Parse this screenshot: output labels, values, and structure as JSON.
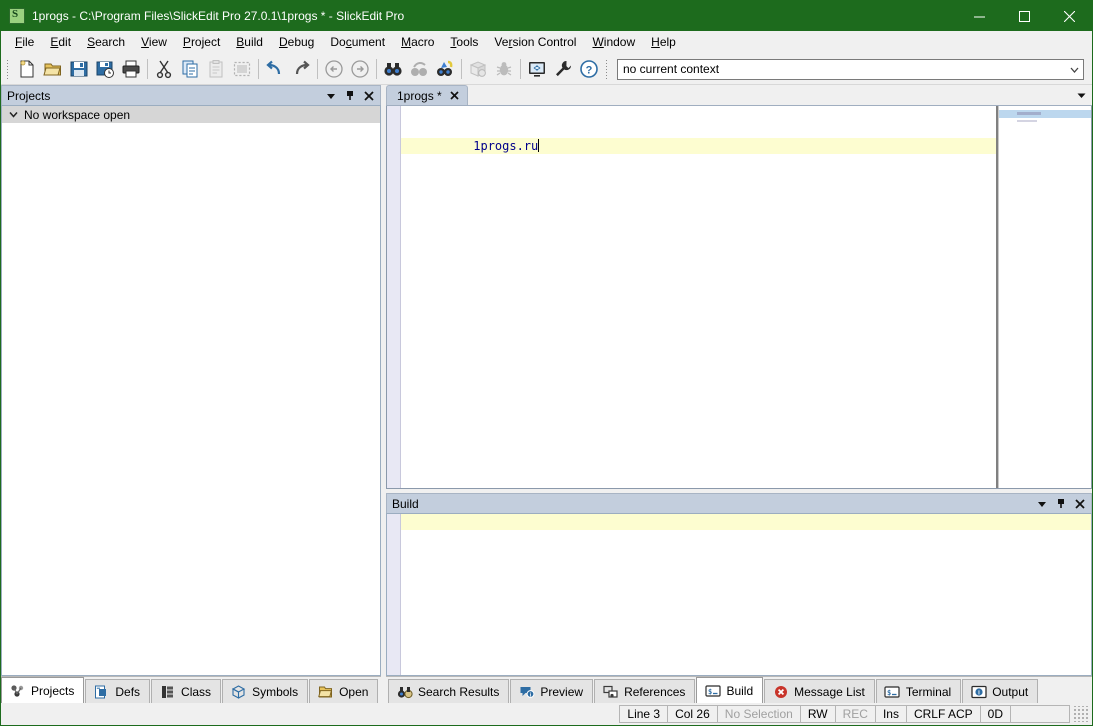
{
  "window": {
    "title": "1progs - C:\\Program Files\\SlickEdit Pro 27.0.1\\1progs * - SlickEdit Pro",
    "app_icon": "slickedit-icon",
    "minimize_label": "Minimize",
    "maximize_label": "Maximize",
    "close_label": "Close",
    "titlebar_color": "#1d6b1d"
  },
  "menubar": {
    "items": [
      {
        "label": "File",
        "accel": "F"
      },
      {
        "label": "Edit",
        "accel": "E"
      },
      {
        "label": "Search",
        "accel": "S"
      },
      {
        "label": "View",
        "accel": "V"
      },
      {
        "label": "Project",
        "accel": "P"
      },
      {
        "label": "Build",
        "accel": "B"
      },
      {
        "label": "Debug",
        "accel": "D"
      },
      {
        "label": "Document",
        "accel": "c"
      },
      {
        "label": "Macro",
        "accel": "M"
      },
      {
        "label": "Tools",
        "accel": "T"
      },
      {
        "label": "Version Control",
        "accel": "r"
      },
      {
        "label": "Window",
        "accel": "W"
      },
      {
        "label": "Help",
        "accel": "H"
      }
    ]
  },
  "toolbar": {
    "buttons": [
      {
        "name": "new-file-icon",
        "tip": "New",
        "enabled": true
      },
      {
        "name": "open-folder-icon",
        "tip": "Open",
        "enabled": true
      },
      {
        "name": "save-icon",
        "tip": "Save",
        "enabled": true
      },
      {
        "name": "save-as-icon",
        "tip": "Save As",
        "enabled": true
      },
      {
        "name": "print-icon",
        "tip": "Print",
        "enabled": true
      },
      {
        "name": "cut-icon",
        "tip": "Cut",
        "enabled": true
      },
      {
        "name": "copy-icon",
        "tip": "Copy",
        "enabled": true
      },
      {
        "name": "paste-icon",
        "tip": "Paste",
        "enabled": false
      },
      {
        "name": "select-all-icon",
        "tip": "Select All",
        "enabled": false
      },
      {
        "name": "undo-icon",
        "tip": "Undo",
        "enabled": true
      },
      {
        "name": "redo-icon",
        "tip": "Redo",
        "enabled": true
      },
      {
        "name": "back-arrow-icon",
        "tip": "Back",
        "enabled": false
      },
      {
        "name": "forward-arrow-icon",
        "tip": "Forward",
        "enabled": false
      },
      {
        "name": "find-icon",
        "tip": "Find",
        "enabled": true
      },
      {
        "name": "find-previous-icon",
        "tip": "Find Previous",
        "enabled": false
      },
      {
        "name": "find-next-icon",
        "tip": "Find Next",
        "enabled": true
      },
      {
        "name": "build-icon",
        "tip": "Build",
        "enabled": false
      },
      {
        "name": "debug-bug-icon",
        "tip": "Debug",
        "enabled": false
      },
      {
        "name": "monitor-icon",
        "tip": "Full Screen",
        "enabled": true
      },
      {
        "name": "wrench-icon",
        "tip": "Configuration",
        "enabled": true
      },
      {
        "name": "help-icon",
        "tip": "Help",
        "enabled": true
      }
    ],
    "context_combo": {
      "value": "no current context",
      "arrow_icon": "chevron-down-icon"
    }
  },
  "projects_panel": {
    "title": "Projects",
    "buttons": [
      {
        "name": "panel-menu-icon",
        "glyph": "menu-down"
      },
      {
        "name": "panel-pin-icon",
        "glyph": "pin"
      },
      {
        "name": "panel-close-icon",
        "glyph": "close"
      }
    ],
    "tree": [
      {
        "label": "No workspace open",
        "expander": "chevron-down-icon",
        "selected": true
      }
    ]
  },
  "left_tabs": {
    "tabs": [
      {
        "label": "Projects",
        "icon": "projects-icon",
        "active": true
      },
      {
        "label": "Defs",
        "icon": "defs-icon",
        "active": false
      },
      {
        "label": "Class",
        "icon": "class-icon",
        "active": false
      },
      {
        "label": "Symbols",
        "icon": "symbols-icon",
        "active": false
      },
      {
        "label": "Open",
        "icon": "open-folder-icon",
        "active": false
      }
    ]
  },
  "editor": {
    "tabs": [
      {
        "label": "1progs *",
        "active": true,
        "close_icon": "close-icon"
      }
    ],
    "tabrow_arrow": "chevron-down-icon",
    "lines": [
      {
        "text": "",
        "current": false
      },
      {
        "text": "",
        "current": false
      },
      {
        "text": "          1progs.ru",
        "current": true,
        "caret": true
      }
    ]
  },
  "build_panel": {
    "title": "Build",
    "buttons": [
      {
        "name": "panel-menu-icon",
        "glyph": "menu-down"
      },
      {
        "name": "panel-pin-icon",
        "glyph": "pin"
      },
      {
        "name": "panel-close-icon",
        "glyph": "close"
      }
    ],
    "content": ""
  },
  "bottom_tabs": {
    "tabs": [
      {
        "label": "Search Results",
        "icon": "binoculars-icon",
        "active": false
      },
      {
        "label": "Preview",
        "icon": "preview-icon",
        "active": false
      },
      {
        "label": "References",
        "icon": "references-icon",
        "active": false
      },
      {
        "label": "Build",
        "icon": "console-icon",
        "active": true
      },
      {
        "label": "Message List",
        "icon": "error-circle-icon",
        "active": false
      },
      {
        "label": "Terminal",
        "icon": "console-icon",
        "active": false
      },
      {
        "label": "Output",
        "icon": "info-circle-icon",
        "active": false
      }
    ]
  },
  "statusbar": {
    "cells": [
      {
        "text": "Line 3",
        "dim": false
      },
      {
        "text": "Col 26",
        "dim": false
      },
      {
        "text": "No Selection",
        "dim": true
      },
      {
        "text": "RW",
        "dim": false
      },
      {
        "text": "REC",
        "dim": true
      },
      {
        "text": "Ins",
        "dim": false
      },
      {
        "text": "CRLF ACP",
        "dim": false
      },
      {
        "text": "0D",
        "dim": false
      },
      {
        "text": "",
        "dim": false
      }
    ]
  }
}
